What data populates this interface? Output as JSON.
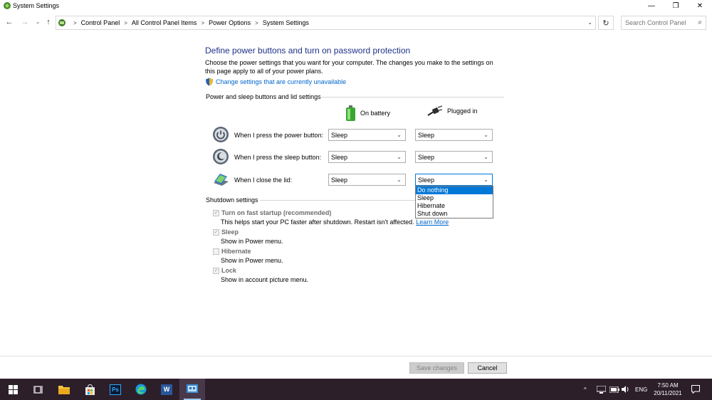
{
  "window": {
    "title": "System Settings",
    "minimize": "—",
    "maximize": "❐",
    "close": "✕"
  },
  "nav": {
    "back": "←",
    "forward": "→",
    "recent": "⌄",
    "up": "↑",
    "breadcrumbs": [
      "Control Panel",
      "All Control Panel Items",
      "Power Options",
      "System Settings"
    ],
    "separator": ">",
    "dropdown": "⌄",
    "refresh": "↻",
    "search_placeholder": "Search Control Panel",
    "search_icon": "⌕"
  },
  "content": {
    "heading": "Define power buttons and turn on password protection",
    "description": "Choose the power settings that you want for your computer. The changes you make to the settings on this page apply to all of your power plans.",
    "change_link": "Change settings that are currently unavailable",
    "section_buttons": "Power and sleep buttons and lid settings",
    "col_battery": "On battery",
    "col_plugged": "Plugged in",
    "rows": [
      {
        "label": "When I press the power button:",
        "battery": "Sleep",
        "plugged": "Sleep"
      },
      {
        "label": "When I press the sleep button:",
        "battery": "Sleep",
        "plugged": "Sleep"
      },
      {
        "label": "When I close the lid:",
        "battery": "Sleep",
        "plugged": "Sleep"
      }
    ],
    "dropdown_options": [
      "Do nothing",
      "Sleep",
      "Hibernate",
      "Shut down"
    ],
    "dropdown_highlighted": "Do nothing",
    "section_shutdown": "Shutdown settings",
    "shutdown": [
      {
        "label": "Turn on fast startup (recommended)",
        "desc": "This helps start your PC faster after shutdown. Restart isn't affected.",
        "link": "Learn More",
        "checked": true
      },
      {
        "label": "Sleep",
        "desc": "Show in Power menu.",
        "checked": true
      },
      {
        "label": "Hibernate",
        "desc": "Show in Power menu.",
        "checked": false
      },
      {
        "label": "Lock",
        "desc": "Show in account picture menu.",
        "checked": true
      }
    ],
    "check_mark": "✓"
  },
  "buttons": {
    "save": "Save changes",
    "cancel": "Cancel"
  },
  "taskbar": {
    "ps_label": "Ps",
    "word_label": "W",
    "tray_chevron": "^",
    "language": "ENG",
    "time": "7:50 AM",
    "date": "20/11/2021"
  },
  "colors": {
    "heading": "#1e3287",
    "link": "#0066cc",
    "highlight": "#0078d7",
    "taskbar": "#2c1f2a"
  }
}
